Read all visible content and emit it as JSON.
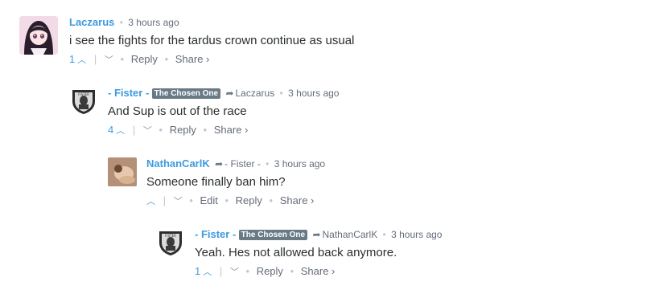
{
  "comments": [
    {
      "author": "Laczarus",
      "time": "3 hours ago",
      "text": "i see the fights for the tardus crown continue as usual",
      "votes": "1",
      "actions": {
        "reply": "Reply",
        "share": "Share ›"
      }
    },
    {
      "author": "- Fister -",
      "badge": "The Chosen One",
      "parent": "Laczarus",
      "time": "3 hours ago",
      "text": "And Sup is out of the race",
      "votes": "4",
      "actions": {
        "reply": "Reply",
        "share": "Share ›"
      }
    },
    {
      "author": "NathanCarlK",
      "parent": "- Fister -",
      "time": "3 hours ago",
      "text": "Someone finally ban him?",
      "actions": {
        "edit": "Edit",
        "reply": "Reply",
        "share": "Share ›"
      }
    },
    {
      "author": "- Fister -",
      "badge": "The Chosen One",
      "parent": "NathanCarlK",
      "time": "3 hours ago",
      "text": "Yeah. Hes not allowed back anymore.",
      "votes": "1",
      "actions": {
        "reply": "Reply",
        "share": "Share ›"
      }
    }
  ],
  "icons": {
    "upvote": "chevron-up-icon",
    "downvote": "chevron-down-icon",
    "in_reply_to": "reply-arrow-icon"
  },
  "colors": {
    "author": "#3d9ae0",
    "badge_bg": "#687a86",
    "text": "#2a2e2e",
    "meta": "#656c7a"
  }
}
